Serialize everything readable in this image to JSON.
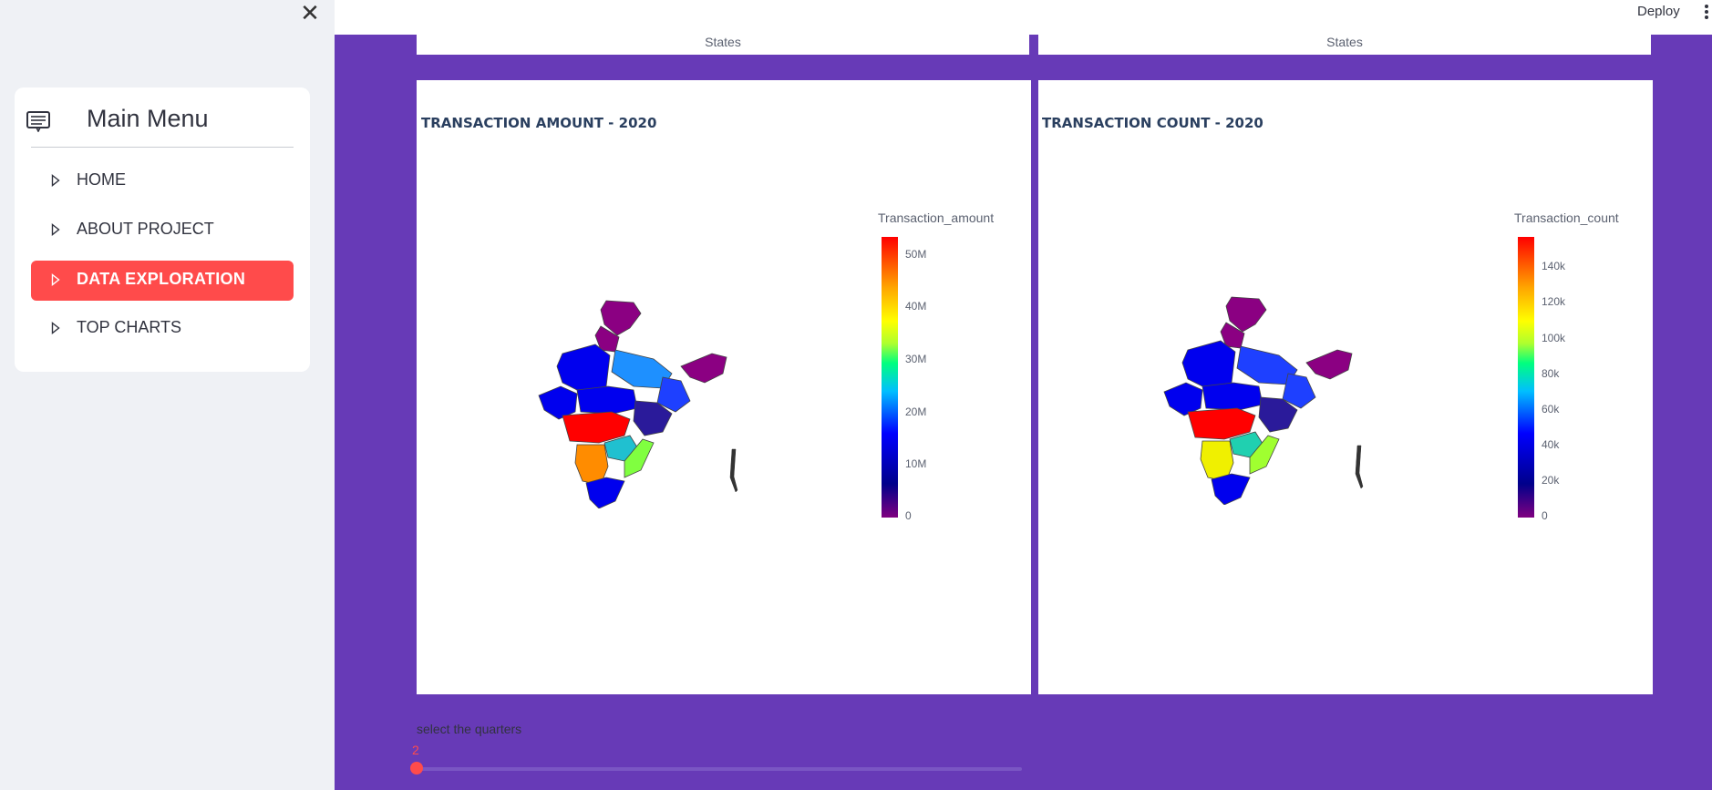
{
  "sidebar": {
    "title": "Main Menu",
    "items": [
      {
        "label": "HOME",
        "active": false
      },
      {
        "label": "ABOUT PROJECT",
        "active": false
      },
      {
        "label": "DATA EXPLORATION",
        "active": true
      },
      {
        "label": "TOP CHARTS",
        "active": false
      }
    ],
    "accent_color": "#ff4b4b"
  },
  "header": {
    "deploy_label": "Deploy"
  },
  "main": {
    "background_color": "#673ab7",
    "strip_left_label": "States",
    "strip_right_label": "States",
    "panels": [
      {
        "title": "TRANSACTION AMOUNT - 2020",
        "colorbar_title": "Transaction_amount",
        "ticks": [
          "50M",
          "40M",
          "30M",
          "20M",
          "10M",
          "0"
        ]
      },
      {
        "title": "TRANSACTION COUNT - 2020",
        "colorbar_title": "Transaction_count",
        "ticks": [
          "140k",
          "120k",
          "100k",
          "80k",
          "60k",
          "40k",
          "20k",
          "0"
        ]
      }
    ],
    "slider": {
      "label": "select the quarters",
      "value": "2"
    }
  }
}
